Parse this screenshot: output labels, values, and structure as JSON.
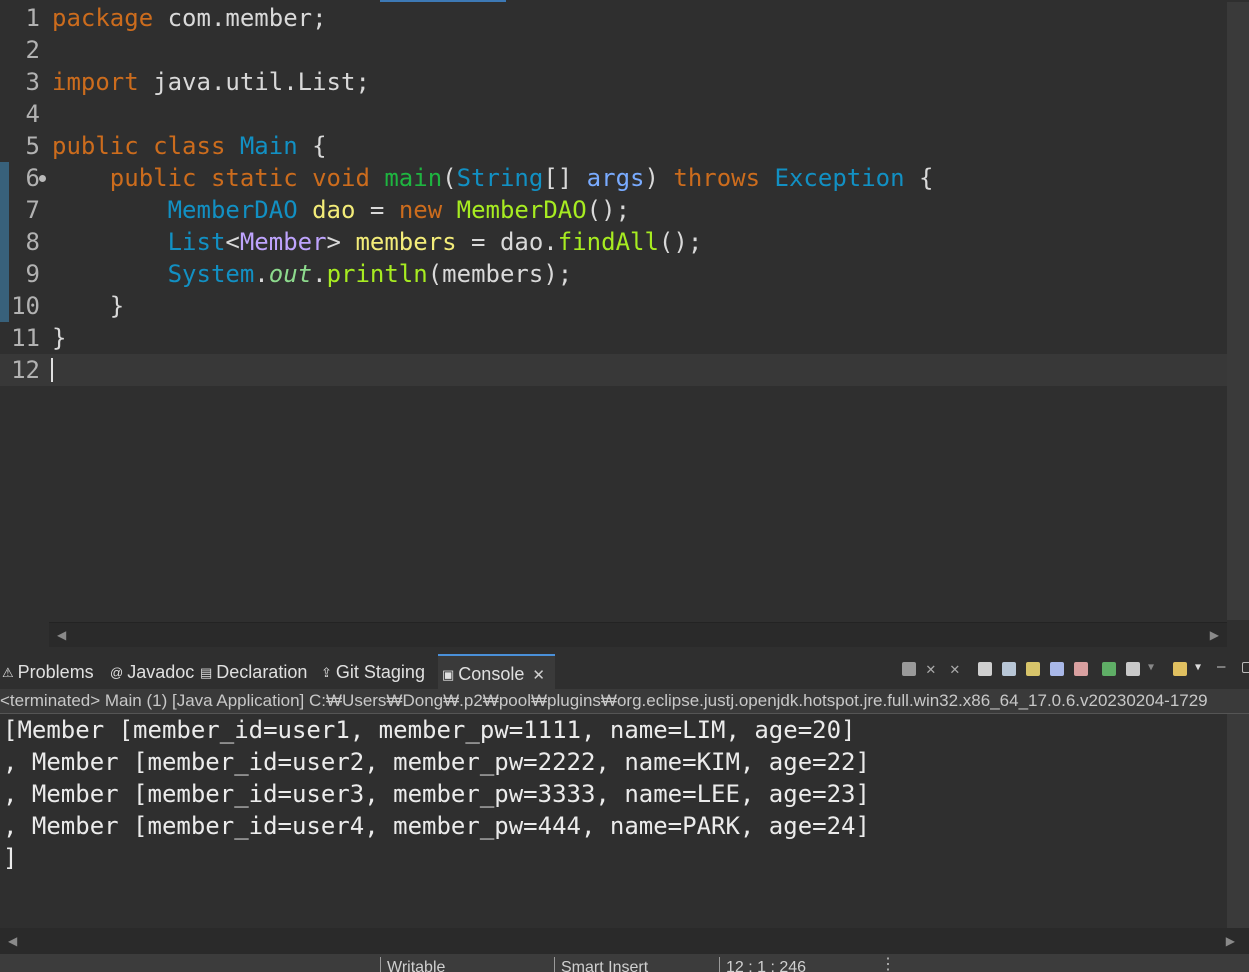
{
  "editor": {
    "lines": [
      {
        "num": "1",
        "tokens": [
          [
            "kw",
            "package"
          ],
          [
            "plain",
            " com.member;"
          ]
        ]
      },
      {
        "num": "2",
        "tokens": []
      },
      {
        "num": "3",
        "tokens": [
          [
            "kw",
            "import"
          ],
          [
            "plain",
            " java.util.List;"
          ]
        ]
      },
      {
        "num": "4",
        "tokens": []
      },
      {
        "num": "5",
        "tokens": [
          [
            "kw",
            "public"
          ],
          [
            "plain",
            " "
          ],
          [
            "kw",
            "class"
          ],
          [
            "plain",
            " "
          ],
          [
            "type",
            "Main"
          ],
          [
            "plain",
            " {"
          ]
        ]
      },
      {
        "num": "6",
        "fold": true,
        "tokens": [
          [
            "plain",
            "    "
          ],
          [
            "kw",
            "public"
          ],
          [
            "plain",
            " "
          ],
          [
            "kw",
            "static"
          ],
          [
            "plain",
            " "
          ],
          [
            "kw",
            "void"
          ],
          [
            "plain",
            " "
          ],
          [
            "method",
            "main"
          ],
          [
            "plain",
            "("
          ],
          [
            "type",
            "String"
          ],
          [
            "plain",
            "[] "
          ],
          [
            "param",
            "args"
          ],
          [
            "plain",
            ") "
          ],
          [
            "kw",
            "throws"
          ],
          [
            "plain",
            " "
          ],
          [
            "type",
            "Exception"
          ],
          [
            "plain",
            " {"
          ]
        ]
      },
      {
        "num": "7",
        "tokens": [
          [
            "plain",
            "        "
          ],
          [
            "type",
            "MemberDAO"
          ],
          [
            "plain",
            " "
          ],
          [
            "var",
            "dao"
          ],
          [
            "plain",
            " = "
          ],
          [
            "kw",
            "new"
          ],
          [
            "plain",
            " "
          ],
          [
            "call",
            "MemberDAO"
          ],
          [
            "plain",
            "();"
          ]
        ]
      },
      {
        "num": "8",
        "tokens": [
          [
            "plain",
            "        "
          ],
          [
            "type",
            "List"
          ],
          [
            "plain",
            "<"
          ],
          [
            "tparam",
            "Member"
          ],
          [
            "plain",
            "> "
          ],
          [
            "var",
            "members"
          ],
          [
            "plain",
            " = dao."
          ],
          [
            "call",
            "findAll"
          ],
          [
            "plain",
            "();"
          ]
        ]
      },
      {
        "num": "9",
        "tokens": [
          [
            "plain",
            "        "
          ],
          [
            "type",
            "System"
          ],
          [
            "plain",
            "."
          ],
          [
            "field",
            "out"
          ],
          [
            "plain",
            "."
          ],
          [
            "call",
            "println"
          ],
          [
            "plain",
            "(members);"
          ]
        ]
      },
      {
        "num": "10",
        "tokens": [
          [
            "plain",
            "    }"
          ]
        ]
      },
      {
        "num": "11",
        "tokens": [
          [
            "plain",
            "}"
          ]
        ]
      },
      {
        "num": "12",
        "tokens": [],
        "caret": true
      }
    ]
  },
  "panel": {
    "tabs": [
      {
        "label": "Problems",
        "icon": "problems-icon",
        "glyph": "⚠"
      },
      {
        "label": "Javadoc",
        "icon": "javadoc-icon",
        "glyph": "@"
      },
      {
        "label": "Declaration",
        "icon": "declaration-icon",
        "glyph": "▤"
      },
      {
        "label": "Git Staging",
        "icon": "git-staging-icon",
        "glyph": "⇪"
      },
      {
        "label": "Console",
        "icon": "console-icon",
        "glyph": "▣",
        "active": true
      }
    ],
    "console_description": "<terminated> Main (1) [Java Application] C:₩Users₩Dong₩.p2₩pool₩plugins₩org.eclipse.justj.openjdk.hotspot.jre.full.win32.x86_64_17.0.6.v20230204-1729",
    "console_output": [
      "[Member [member_id=user1, member_pw=1111, name=LIM, age=20]",
      ", Member [member_id=user2, member_pw=2222, name=KIM, age=22]",
      ", Member [member_id=user3, member_pw=3333, name=LEE, age=23]",
      ", Member [member_id=user4, member_pw=444, name=PARK, age=24]",
      "]"
    ]
  },
  "status": {
    "writable": "Writable",
    "insert_mode": "Smart Insert",
    "position": "12 : 1 : 246"
  },
  "colors": {
    "keyword": "#cc6c1d",
    "type": "#1290c3",
    "method": "#1eb540",
    "variable": "#f3ec79",
    "call": "#a7ec21",
    "type_param": "#bfa4fe",
    "active_tab": "#4a90d9"
  }
}
